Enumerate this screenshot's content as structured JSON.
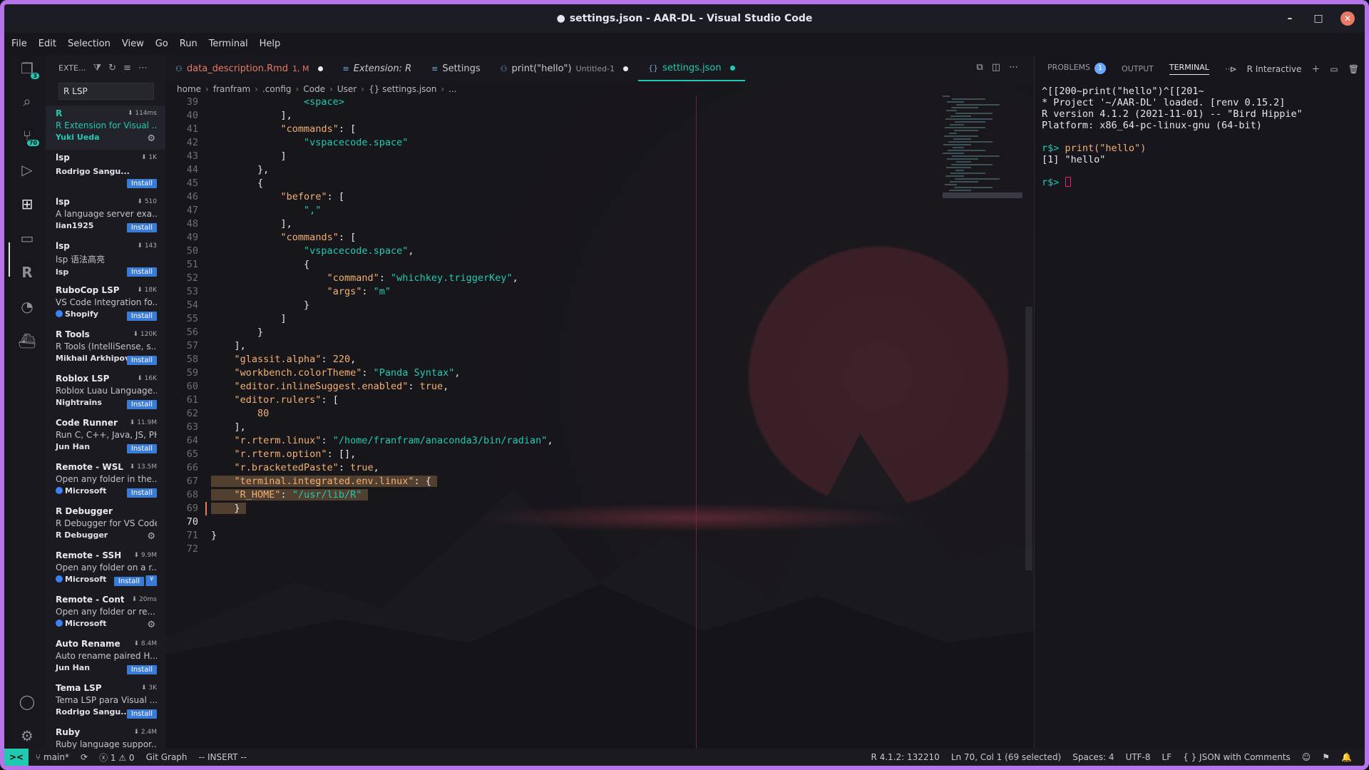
{
  "window": {
    "title": "settings.json - AAR-DL - Visual Studio Code",
    "modified_dot": "●",
    "controls": [
      "–",
      "□",
      "✕"
    ]
  },
  "menu": [
    "File",
    "Edit",
    "Selection",
    "View",
    "Go",
    "Run",
    "Terminal",
    "Help"
  ],
  "activity": {
    "explorer_badge": "3",
    "scm_badge": "70"
  },
  "sidebar": {
    "title": "EXTE...",
    "search_value": "R LSP",
    "extensions": [
      {
        "name": "R",
        "stat": "114ms",
        "desc": "R Extension for Visual ...",
        "publisher": "Yuki Ueda",
        "action": "gear",
        "selected": true
      },
      {
        "name": "lsp",
        "stat": "1K",
        "desc": "",
        "publisher": "Rodrigo Sangu...",
        "action": "Install"
      },
      {
        "name": "lsp",
        "stat": "510",
        "desc": "A language server exa...",
        "publisher": "lian1925",
        "action": "Install"
      },
      {
        "name": "lsp",
        "stat": "143",
        "desc": "lsp 语法高亮",
        "publisher": "lsp",
        "action": "Install"
      },
      {
        "name": "RuboCop LSP",
        "stat": "18K",
        "desc": "VS Code Integration fo...",
        "publisher": "Shopify",
        "verified": true,
        "action": "Install"
      },
      {
        "name": "R Tools",
        "stat": "120K",
        "desc": "R Tools (IntelliSense, s...",
        "publisher": "Mikhail Arkhipov",
        "action": "Install"
      },
      {
        "name": "Roblox LSP",
        "stat": "16K",
        "desc": "Roblox Luau Language...",
        "publisher": "Nightrains",
        "action": "Install"
      },
      {
        "name": "Code Runner",
        "stat": "11.9M",
        "desc": "Run C, C++, Java, JS, PH...",
        "publisher": "Jun Han",
        "action": "Install"
      },
      {
        "name": "Remote - WSL",
        "stat": "13.5M",
        "desc": "Open any folder in the...",
        "publisher": "Microsoft",
        "verified": true,
        "action": "Install"
      },
      {
        "name": "R Debugger",
        "stat": "",
        "desc": "R Debugger for VS Code",
        "publisher": "R Debugger",
        "action": "gear"
      },
      {
        "name": "Remote - SSH",
        "stat": "9.9M",
        "desc": "Open any folder on a r...",
        "publisher": "Microsoft",
        "verified": true,
        "action": "Install-split"
      },
      {
        "name": "Remote - Cont...",
        "stat": "20ms",
        "desc": "Open any folder or re...",
        "publisher": "Microsoft",
        "verified": true,
        "action": "gear"
      },
      {
        "name": "Auto Rename ...",
        "stat": "8.4M",
        "desc": "Auto rename paired H...",
        "publisher": "Jun Han",
        "action": "Install"
      },
      {
        "name": "Tema LSP",
        "stat": "3K",
        "desc": "Tema LSP para Visual ...",
        "publisher": "Rodrigo Sangu...",
        "action": "Install"
      },
      {
        "name": "Ruby",
        "stat": "2.4M",
        "desc": "Ruby language suppor...",
        "publisher": "",
        "action": ""
      }
    ]
  },
  "tabs": [
    {
      "label": "data_description.Rmd",
      "extra": "1, M",
      "dirty": true,
      "style": "mod"
    },
    {
      "label": "Extension: R",
      "extra": "",
      "dirty": false,
      "style": "italic"
    },
    {
      "label": "Settings",
      "extra": "",
      "dirty": false,
      "style": "normal"
    },
    {
      "label": "print(\"hello\")",
      "extra": "Untitled-1",
      "dirty": true,
      "style": "normal"
    },
    {
      "label": "settings.json",
      "extra": "",
      "dirty": true,
      "style": "active"
    }
  ],
  "breadcrumb": [
    "home",
    "franfram",
    ".config",
    "Code",
    "User",
    "{} settings.json",
    "..."
  ],
  "code_lines": [
    {
      "n": "39",
      "html": "                <span class=\"s\">&lt;space&gt;</span>"
    },
    {
      "n": "40",
      "html": "            ],"
    },
    {
      "n": "41",
      "html": "            <span class=\"k\">\"commands\"</span>: ["
    },
    {
      "n": "42",
      "html": "                <span class=\"s\">\"vspacecode.space\"</span>"
    },
    {
      "n": "43",
      "html": "            ]"
    },
    {
      "n": "44",
      "html": "        },"
    },
    {
      "n": "45",
      "html": "        {"
    },
    {
      "n": "46",
      "html": "            <span class=\"k\">\"before\"</span>: ["
    },
    {
      "n": "47",
      "html": "                <span class=\"s\">\",\"</span>"
    },
    {
      "n": "48",
      "html": "            ],"
    },
    {
      "n": "49",
      "html": "            <span class=\"k\">\"commands\"</span>: ["
    },
    {
      "n": "50",
      "html": "                <span class=\"s\">\"vspacecode.space\"</span>,"
    },
    {
      "n": "51",
      "html": "                {"
    },
    {
      "n": "52",
      "html": "                    <span class=\"k\">\"command\"</span>: <span class=\"s\">\"whichkey.triggerKey\"</span>,"
    },
    {
      "n": "53",
      "html": "                    <span class=\"k\">\"args\"</span>: <span class=\"s\">\"m\"</span>"
    },
    {
      "n": "54",
      "html": "                }"
    },
    {
      "n": "55",
      "html": "            ]"
    },
    {
      "n": "56",
      "html": "        }"
    },
    {
      "n": "57",
      "html": "    ],"
    },
    {
      "n": "58",
      "html": "    <span class=\"k\">\"glassit.alpha\"</span>: <span class=\"n\">220</span>,"
    },
    {
      "n": "59",
      "html": "    <span class=\"k\">\"workbench.colorTheme\"</span>: <span class=\"s\">\"Panda Syntax\"</span>,"
    },
    {
      "n": "60",
      "html": "    <span class=\"k\">\"editor.inlineSuggest.enabled\"</span>: <span class=\"kw\">true</span>,"
    },
    {
      "n": "61",
      "html": "    <span class=\"k\">\"editor.rulers\"</span>: ["
    },
    {
      "n": "62",
      "html": "        <span class=\"n\">80</span>"
    },
    {
      "n": "63",
      "html": "    ],"
    },
    {
      "n": "64",
      "html": "    <span class=\"k\">\"r.rterm.linux\"</span>: <span class=\"s\">\"/home/franfram/anaconda3/bin/radian\"</span>,"
    },
    {
      "n": "65",
      "html": "    <span class=\"k\">\"r.rterm.option\"</span>: [],"
    },
    {
      "n": "66",
      "html": "    <span class=\"k\">\"r.bracketedPaste\"</span>: <span class=\"kw\">true</span>,"
    },
    {
      "n": "67",
      "sel": true,
      "html": "<span class=\"hl\">    <span class=\"k\">\"terminal.integrated.env.linux\"</span>: { </span>"
    },
    {
      "n": "68",
      "sel": true,
      "html": "<span class=\"hl\">    <span class=\"k\">\"R_HOME\"</span>: <span class=\"s\">\"/usr/lib/R\"</span> </span>"
    },
    {
      "n": "69",
      "sel": true,
      "html": "<span class=\"hl\">    } </span>"
    },
    {
      "n": "70",
      "cur": true,
      "html": ""
    },
    {
      "n": "71",
      "html": "}"
    },
    {
      "n": "72",
      "html": ""
    }
  ],
  "panel": {
    "tabs": [
      "PROBLEMS",
      "OUTPUT",
      "TERMINAL"
    ],
    "problems_count": "1",
    "terminal_name": "R Interactive",
    "terminal_lines": [
      "^[[200~print(\"hello\")^[[201~",
      "* Project '~/AAR-DL' loaded. [renv 0.15.2]",
      "R version 4.1.2 (2021-11-01) -- \"Bird Hippie\"",
      "Platform: x86_64-pc-linux-gnu (64-bit)"
    ],
    "prompt": "r$>",
    "command": "print(\"hello\")",
    "output": "[1] \"hello\""
  },
  "status": {
    "remote": "><",
    "branch": "main*",
    "errors": "1",
    "warnings": "0",
    "git_graph": "Git Graph",
    "mode": "-- INSERT --",
    "r_version": "R 4.1.2: 132210",
    "cursor": "Ln 70, Col 1 (69 selected)",
    "spaces": "Spaces: 4",
    "encoding": "UTF-8",
    "eol": "LF",
    "language": "JSON with Comments"
  }
}
